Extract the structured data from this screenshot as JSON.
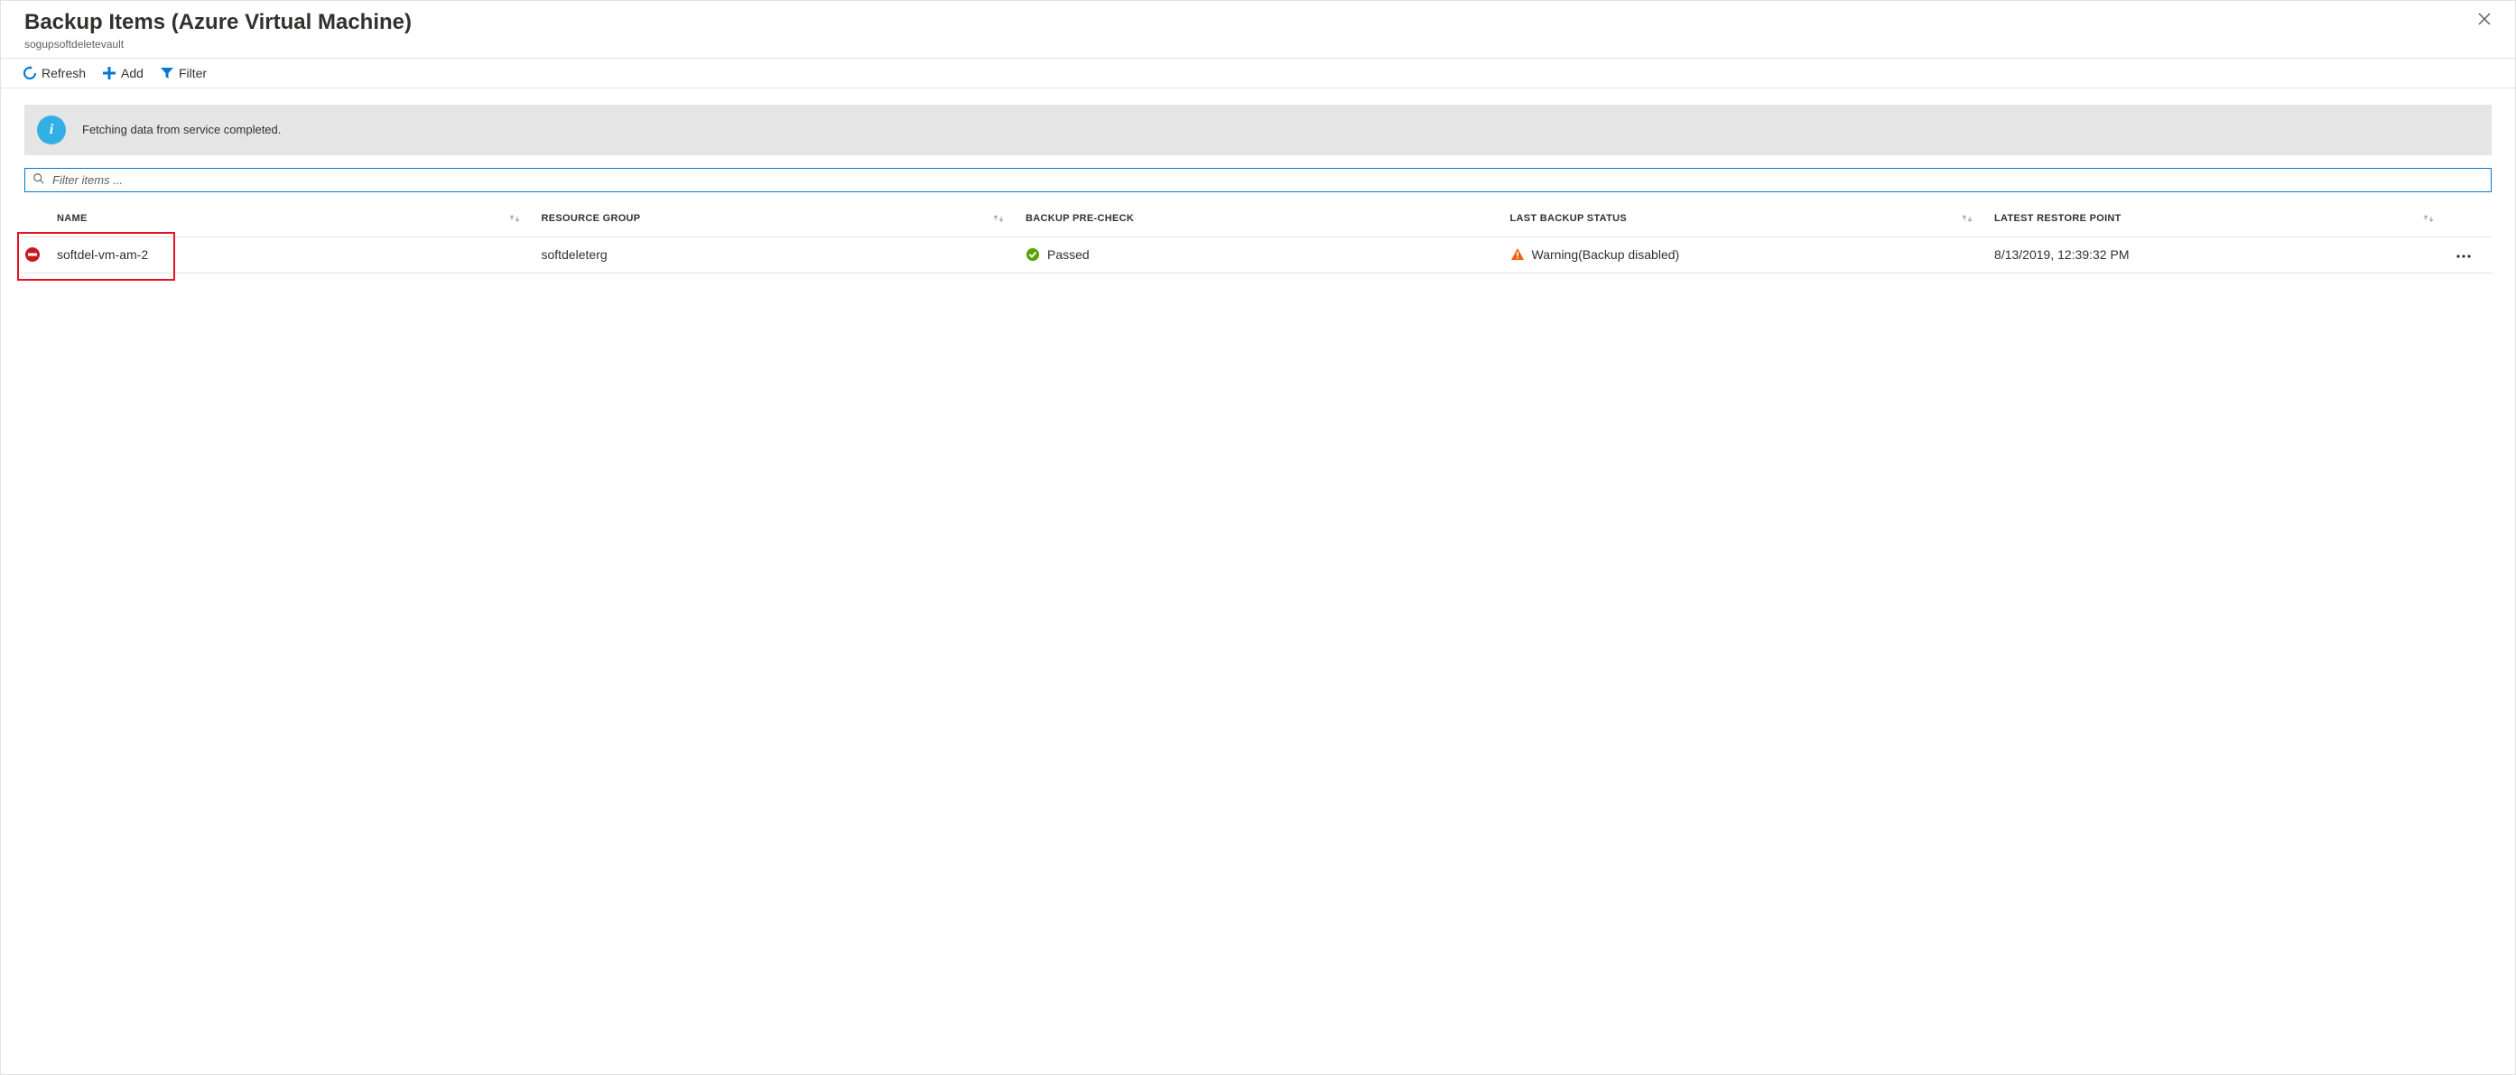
{
  "header": {
    "title": "Backup Items (Azure Virtual Machine)",
    "subtitle": "sogupsoftdeletevault"
  },
  "toolbar": {
    "refresh_label": "Refresh",
    "add_label": "Add",
    "filter_label": "Filter"
  },
  "notice": {
    "message": "Fetching data from service completed."
  },
  "filter": {
    "placeholder": "Filter items ..."
  },
  "columns": {
    "name": "Name",
    "resource_group": "Resource Group",
    "backup_pre_check": "Backup Pre-Check",
    "last_backup_status": "Last Backup Status",
    "latest_restore_point": "Latest Restore Point"
  },
  "rows": [
    {
      "name": "softdel-vm-am-2",
      "resource_group": "softdeleterg",
      "pre_check": "Passed",
      "last_status": "Warning(Backup disabled)",
      "restore_point": "8/13/2019, 12:39:32 PM"
    }
  ],
  "colors": {
    "accent": "#0078d4",
    "warning": "#f2610c",
    "success": "#57a300",
    "danger": "#e81123",
    "info": "#32b0e6"
  }
}
